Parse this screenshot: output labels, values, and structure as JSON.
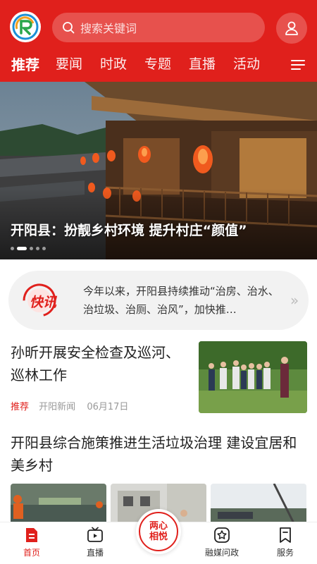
{
  "theme": {
    "accent": "#e0201c"
  },
  "header": {
    "logo_icon": "app-logo-icon",
    "search_placeholder": "搜索关键词",
    "user_icon": "user-icon"
  },
  "tabs": [
    {
      "label": "推荐",
      "active": true
    },
    {
      "label": "要闻"
    },
    {
      "label": "时政"
    },
    {
      "label": "专题"
    },
    {
      "label": "直播"
    },
    {
      "label": "活动"
    }
  ],
  "banner": {
    "title": "开阳县：扮靓乡村环境 提升村庄“颜值”",
    "slide_count": 5,
    "active_slide": 2
  },
  "flash": {
    "badge": "快讯",
    "text": "今年以来，开阳县持续推动“治房、治水、治垃圾、治厕、治风”，加快推…",
    "arrow": "»"
  },
  "articles": [
    {
      "title": "孙昕开展安全检查及巡河、巡林工作",
      "tag": "推荐",
      "source": "开阳新闻",
      "date": "06月17日"
    },
    {
      "title": "开阳县综合施策推进生活垃圾治理 建设宜居和美乡村"
    }
  ],
  "bottom_nav": [
    {
      "label": "首页",
      "icon": "home-doc-icon",
      "active": true
    },
    {
      "label": "直播",
      "icon": "tv-icon"
    },
    {
      "label_line1": "两心",
      "label_line2": "相悦",
      "icon": "center-brand-icon"
    },
    {
      "label": "融媒问政",
      "icon": "star-badge-icon"
    },
    {
      "label": "服务",
      "icon": "bookmark-icon"
    }
  ]
}
